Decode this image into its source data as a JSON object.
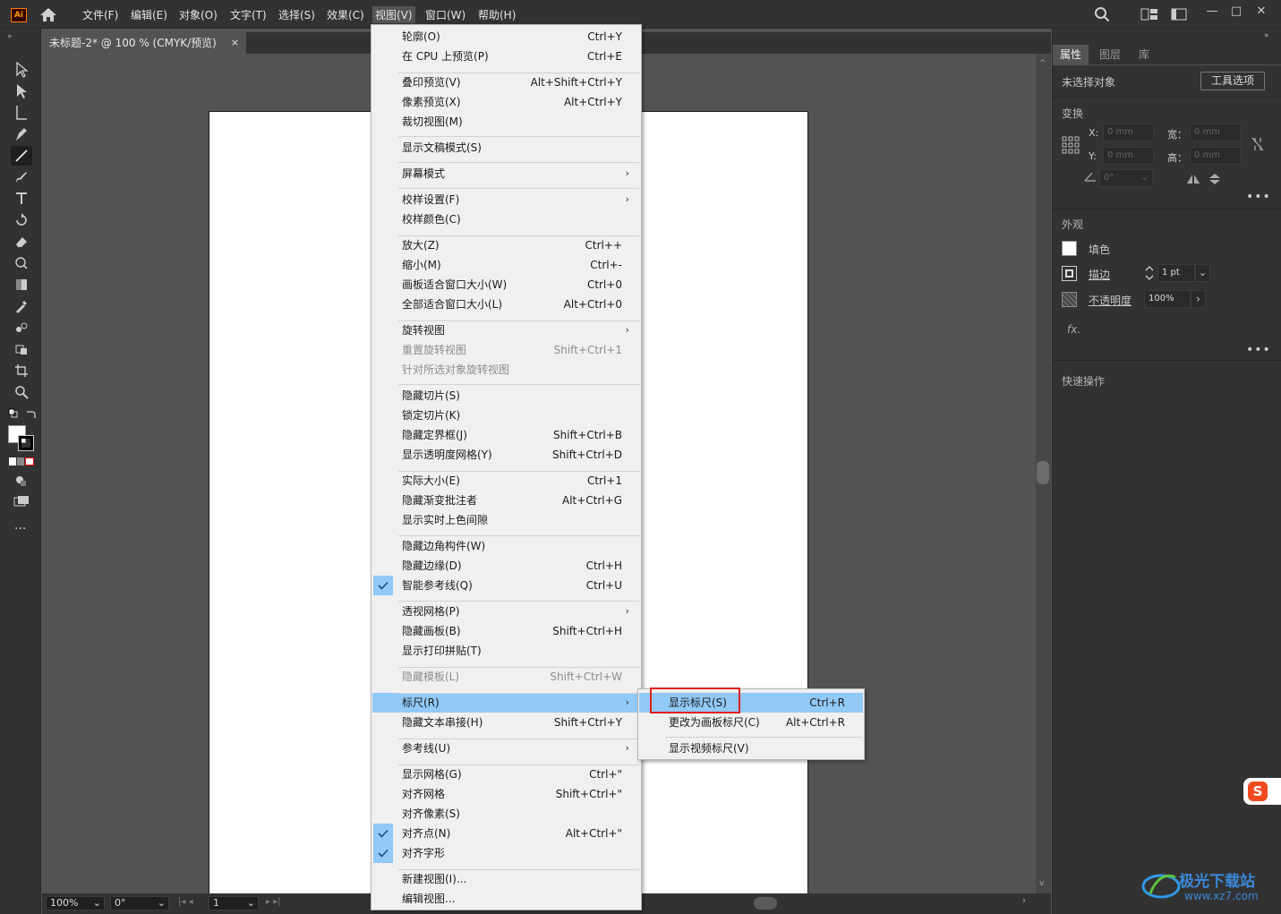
{
  "app": {
    "logo": "Ai",
    "home_icon": "home-icon"
  },
  "menubar": {
    "items": [
      "文件(F)",
      "编辑(E)",
      "对象(O)",
      "文字(T)",
      "选择(S)",
      "效果(C)",
      "视图(V)",
      "窗口(W)",
      "帮助(H)"
    ],
    "active": "视图(V)"
  },
  "document": {
    "tab_title": "未标题-2* @ 100 % (CMYK/预览)",
    "close": "×"
  },
  "view_menu": [
    {
      "label": "轮廓(O)",
      "shortcut": "Ctrl+Y"
    },
    {
      "label": "在 CPU 上预览(P)",
      "shortcut": "Ctrl+E"
    },
    {
      "label": "叠印预览(V)",
      "shortcut": "Alt+Shift+Ctrl+Y"
    },
    {
      "label": "像素预览(X)",
      "shortcut": "Alt+Ctrl+Y"
    },
    {
      "label": "裁切视图(M)",
      "shortcut": ""
    },
    {
      "label": "显示文稿模式(S)",
      "shortcut": ""
    },
    {
      "label": "屏幕模式",
      "shortcut": "",
      "submenu": true
    },
    {
      "label": "校样设置(F)",
      "shortcut": "",
      "submenu": true
    },
    {
      "label": "校样颜色(C)",
      "shortcut": ""
    },
    {
      "label": "放大(Z)",
      "shortcut": "Ctrl++"
    },
    {
      "label": "缩小(M)",
      "shortcut": "Ctrl+-"
    },
    {
      "label": "画板适合窗口大小(W)",
      "shortcut": "Ctrl+0"
    },
    {
      "label": "全部适合窗口大小(L)",
      "shortcut": "Alt+Ctrl+0"
    },
    {
      "label": "旋转视图",
      "shortcut": "",
      "submenu": true
    },
    {
      "label": "重置旋转视图",
      "shortcut": "Shift+Ctrl+1",
      "disabled": true
    },
    {
      "label": "针对所选对象旋转视图",
      "shortcut": "",
      "disabled": true
    },
    {
      "label": "隐藏切片(S)",
      "shortcut": ""
    },
    {
      "label": "锁定切片(K)",
      "shortcut": ""
    },
    {
      "label": "隐藏定界框(J)",
      "shortcut": "Shift+Ctrl+B"
    },
    {
      "label": "显示透明度网格(Y)",
      "shortcut": "Shift+Ctrl+D"
    },
    {
      "label": "实际大小(E)",
      "shortcut": "Ctrl+1"
    },
    {
      "label": "隐藏渐变批注者",
      "shortcut": "Alt+Ctrl+G"
    },
    {
      "label": "显示实时上色间隙",
      "shortcut": ""
    },
    {
      "label": "隐藏边角构件(W)",
      "shortcut": ""
    },
    {
      "label": "隐藏边缘(D)",
      "shortcut": "Ctrl+H"
    },
    {
      "label": "智能参考线(Q)",
      "shortcut": "Ctrl+U",
      "checked": true
    },
    {
      "label": "透视网格(P)",
      "shortcut": "",
      "submenu": true
    },
    {
      "label": "隐藏画板(B)",
      "shortcut": "Shift+Ctrl+H"
    },
    {
      "label": "显示打印拼贴(T)",
      "shortcut": ""
    },
    {
      "label": "隐藏模板(L)",
      "shortcut": "Shift+Ctrl+W",
      "disabled": true
    },
    {
      "label": "标尺(R)",
      "shortcut": "",
      "submenu": true,
      "highlighted": true
    },
    {
      "label": "隐藏文本串接(H)",
      "shortcut": "Shift+Ctrl+Y"
    },
    {
      "label": "参考线(U)",
      "shortcut": "",
      "submenu": true
    },
    {
      "label": "显示网格(G)",
      "shortcut": "Ctrl+\""
    },
    {
      "label": "对齐网格",
      "shortcut": "Shift+Ctrl+\""
    },
    {
      "label": "对齐像素(S)",
      "shortcut": ""
    },
    {
      "label": "对齐点(N)",
      "shortcut": "Alt+Ctrl+\"",
      "checked": true
    },
    {
      "label": "对齐字形",
      "shortcut": "",
      "checked": true
    },
    {
      "label": "新建视图(I)...",
      "shortcut": ""
    },
    {
      "label": "编辑视图...",
      "shortcut": ""
    }
  ],
  "ruler_submenu": [
    {
      "label": "显示标尺(S)",
      "shortcut": "Ctrl+R",
      "highlighted": true
    },
    {
      "label": "更改为画板标尺(C)",
      "shortcut": "Alt+Ctrl+R"
    },
    {
      "label": "显示视频标尺(V)",
      "shortcut": ""
    }
  ],
  "status": {
    "zoom": "100%",
    "rotation": "0°",
    "artboard": "1"
  },
  "panel": {
    "tabs": [
      "属性",
      "图层",
      "库"
    ],
    "no_selection": "未选择对象",
    "tool_options": "工具选项",
    "transform": "变换",
    "x_label": "X:",
    "y_label": "Y:",
    "w_label": "宽：",
    "h_label": "高：",
    "x_value": "0 mm",
    "y_value": "0 mm",
    "w_value": "0 mm",
    "h_value": "0 mm",
    "angle": "0°",
    "appearance": "外观",
    "fill": "填色",
    "stroke": "描边",
    "stroke_value": "1 pt",
    "opacity": "不透明度",
    "opacity_value": "100%",
    "fx": "fx.",
    "quick_actions": "快速操作"
  },
  "watermark": {
    "text": "极光下载站",
    "url": "www.xz7.com"
  },
  "colors": {
    "menu_highlight": "#91c9f7",
    "red_box": "#e02020",
    "panel_bg": "#323232",
    "canvas_bg": "#535353"
  }
}
